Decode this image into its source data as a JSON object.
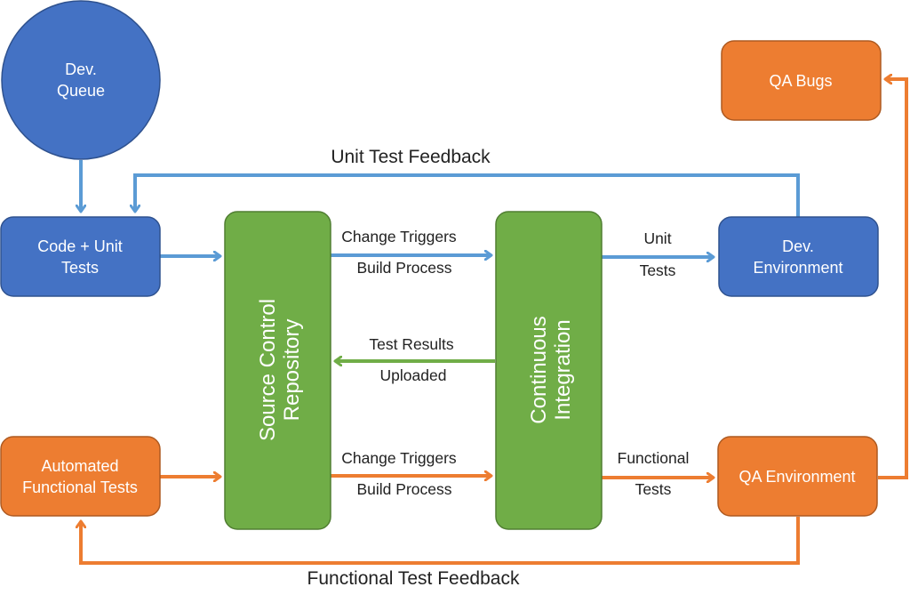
{
  "colors": {
    "blue_node": "#4472C4",
    "blue_arrow": "#5B9BD5",
    "orange": "#ED7D31",
    "green": "#70AD47",
    "label": "#222222"
  },
  "nodes": {
    "dev_queue": {
      "line1": "Dev.",
      "line2": "Queue"
    },
    "code_unit_tests": {
      "line1": "Code + Unit",
      "line2": "Tests"
    },
    "source_control": {
      "line1": "Source Control",
      "line2": "Repository"
    },
    "continuous_integration": {
      "line1": "Continuous",
      "line2": "Integration"
    },
    "dev_environment": {
      "line1": "Dev.",
      "line2": "Environment"
    },
    "qa_bugs": {
      "label": "QA Bugs"
    },
    "automated_functional_tests": {
      "line1": "Automated",
      "line2": "Functional Tests"
    },
    "qa_environment": {
      "label": "QA Environment"
    }
  },
  "edges": {
    "unit_test_feedback": {
      "label": "Unit Test Feedback"
    },
    "change_triggers_top": {
      "line1": "Change Triggers",
      "line2": "Build Process"
    },
    "unit_tests": {
      "line1": "Unit",
      "line2": "Tests"
    },
    "test_results": {
      "line1": "Test Results",
      "line2": "Uploaded"
    },
    "change_triggers_bottom": {
      "line1": "Change Triggers",
      "line2": "Build Process"
    },
    "functional_tests": {
      "line1": "Functional",
      "line2": "Tests"
    },
    "functional_test_feedback": {
      "label": "Functional Test Feedback"
    }
  }
}
